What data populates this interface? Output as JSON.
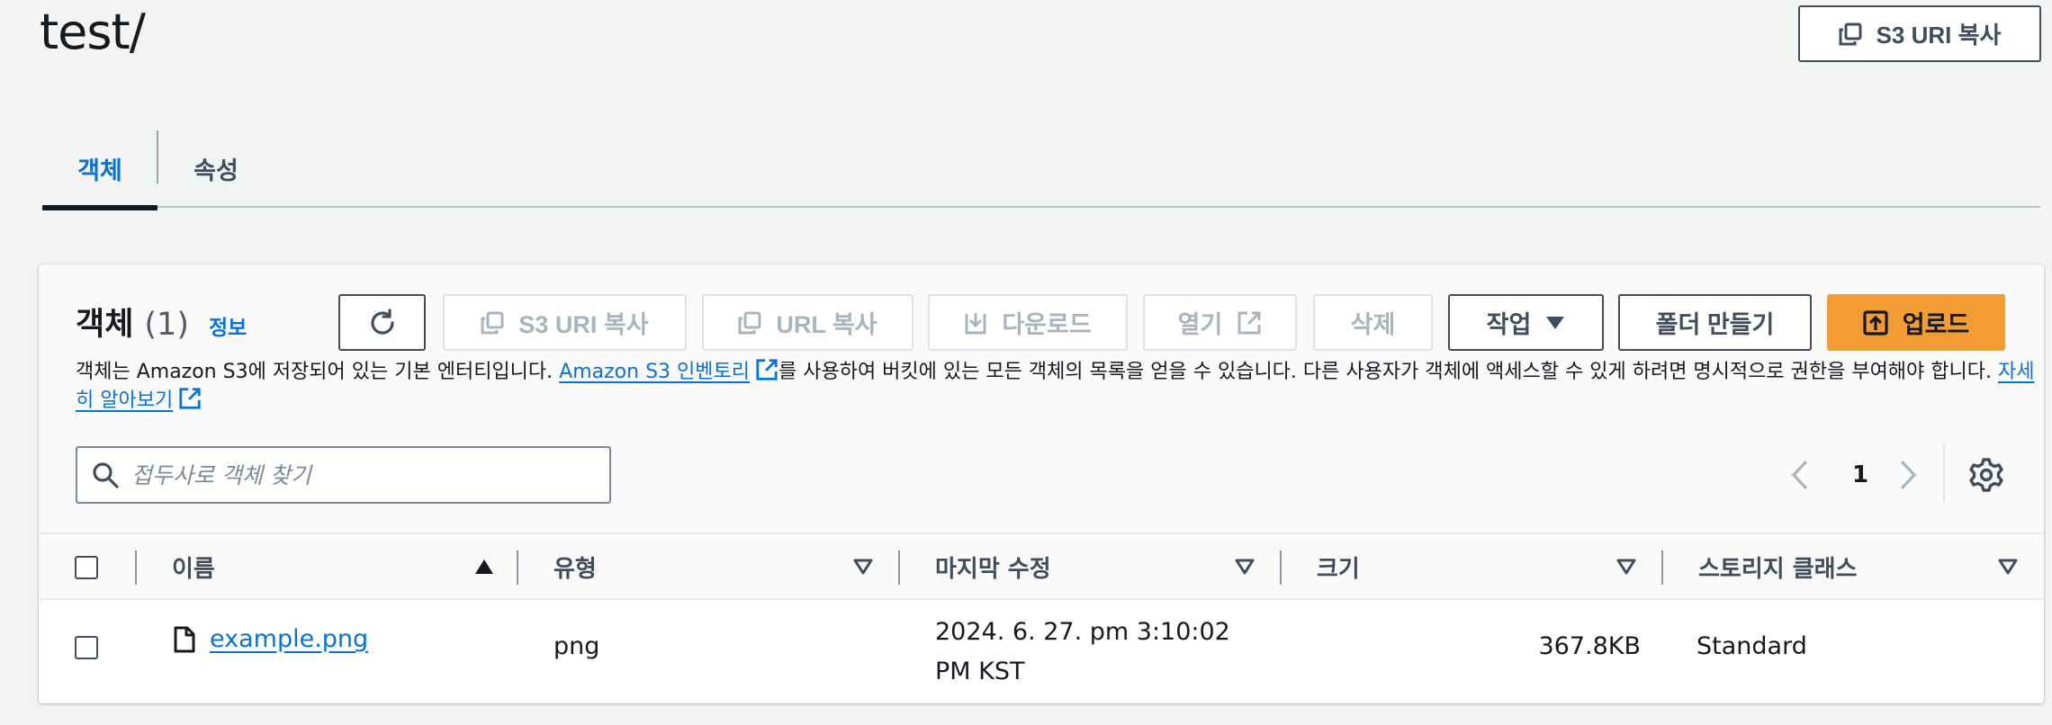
{
  "page": {
    "title": "test/",
    "copy_uri_label": "S3 URI 복사"
  },
  "tabs": [
    {
      "label": "객체",
      "active": true
    },
    {
      "label": "속성",
      "active": false
    }
  ],
  "panel": {
    "title": "객체",
    "count": "(1)",
    "info_link": "정보",
    "actions": {
      "refresh": "refresh-icon",
      "copy_s3_uri": "S3 URI 복사",
      "copy_url": "URL 복사",
      "download": "다운로드",
      "open": "열기",
      "delete": "삭제",
      "actions": "작업",
      "create_folder": "폴더 만들기",
      "upload": "업로드"
    },
    "description": {
      "part1": "객체는 Amazon S3에 저장되어 있는 기본 엔터티입니다. ",
      "inventory_link": "Amazon S3 인벤토리",
      "part2": "를 사용하여 버킷에 있는 모든 객체의 목록을 얻을 수 있습니다. 다른 사용자가 객체에 액세스할 수 있게 하려면 명시적으로 권한을 부여해야 합니다. ",
      "learn_more_link": "자세히 알아보기"
    },
    "search": {
      "placeholder": "접두사로 객체 찾기",
      "value": ""
    },
    "pagination": {
      "current_page": "1"
    },
    "table": {
      "columns": [
        "이름",
        "유형",
        "마지막 수정",
        "크기",
        "스토리지 클래스"
      ],
      "rows": [
        {
          "name": "example.png",
          "type": "png",
          "last_modified_line1": "2024. 6. 27. pm 3:10:02",
          "last_modified_line2": "PM KST",
          "size": "367.8KB",
          "storage_class": "Standard"
        }
      ]
    }
  },
  "colors": {
    "link": "#0972d3",
    "primary_button": "#f39c34",
    "text": "#16191f",
    "background": "#f2f3f3"
  }
}
